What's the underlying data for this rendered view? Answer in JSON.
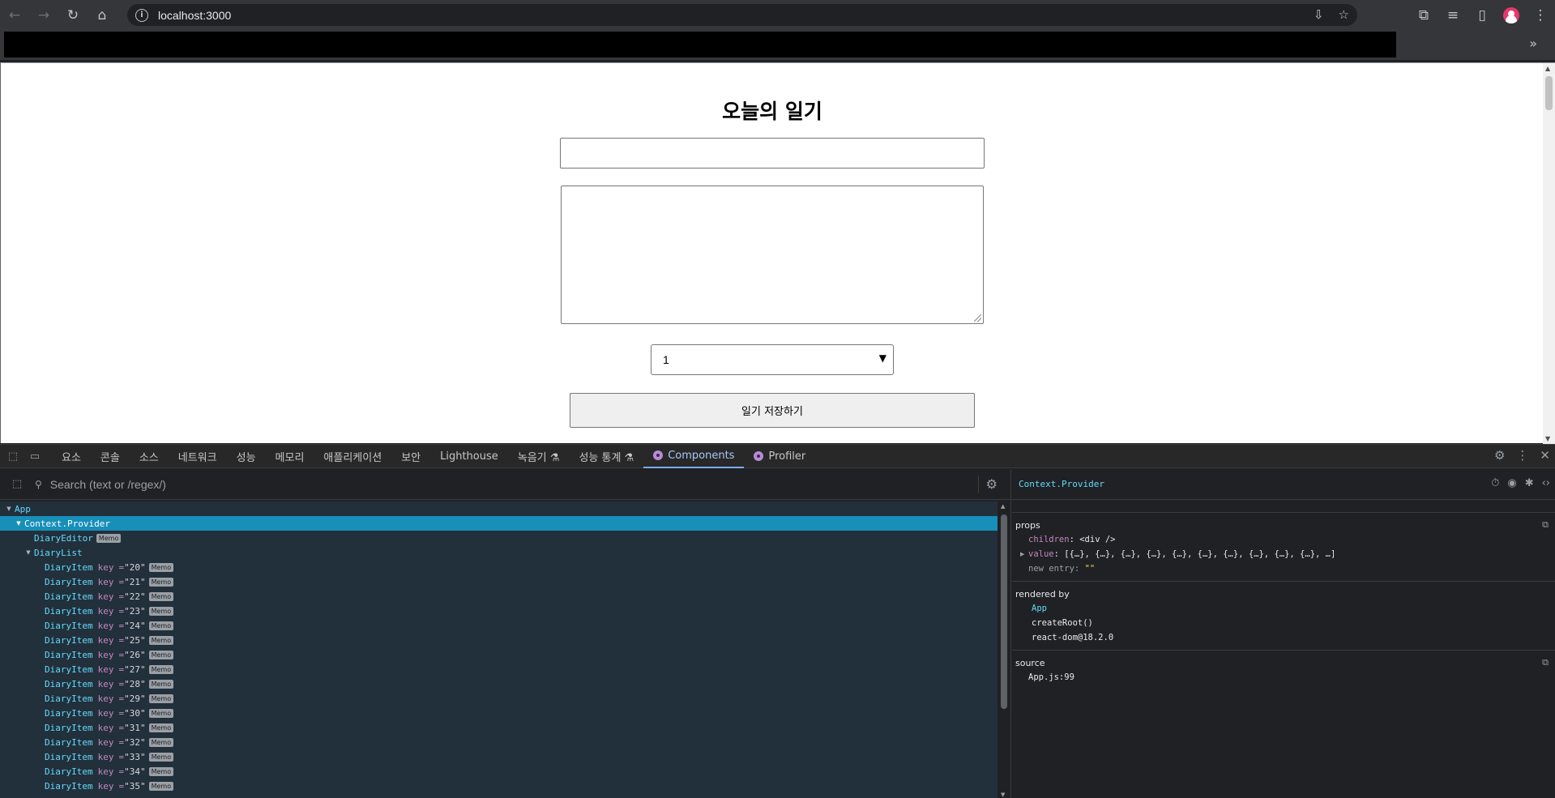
{
  "browser": {
    "url": "localhost:3000"
  },
  "page": {
    "title": "오늘의 일기",
    "author_value": "",
    "content_value": "",
    "emotion_selected": "1",
    "save_button": "일기 저장하기"
  },
  "devtools": {
    "tabs": [
      "요소",
      "콘솔",
      "소스",
      "네트워크",
      "성능",
      "메모리",
      "애플리케이션",
      "보안",
      "Lighthouse",
      "녹음기 ⚗",
      "성능 통계 ⚗"
    ],
    "react_tabs": [
      "Components",
      "Profiler"
    ],
    "active_tab": "Components",
    "search_placeholder": "Search (text or /regex/)",
    "tree": {
      "app": "App",
      "provider": "Context.Provider",
      "editor": "DiaryEditor",
      "list": "DiaryList",
      "item_name": "DiaryItem",
      "key_label": "key",
      "badge": "Memo",
      "item_keys": [
        "\"20\"",
        "\"21\"",
        "\"22\"",
        "\"23\"",
        "\"24\"",
        "\"25\"",
        "\"26\"",
        "\"27\"",
        "\"28\"",
        "\"29\"",
        "\"30\"",
        "\"31\"",
        "\"32\"",
        "\"33\"",
        "\"34\"",
        "\"35\""
      ]
    },
    "inspector": {
      "title": "Context.Provider",
      "props_label": "props",
      "children_key": "children",
      "children_val": "<div />",
      "value_key": "value",
      "value_val": "[{…}, {…}, {…}, {…}, {…}, {…}, {…}, {…}, {…}, {…}, …]",
      "new_entry_key": "new entry",
      "new_entry_val": "\"\"",
      "rendered_by_label": "rendered by",
      "rendered_by": [
        "App",
        "createRoot()",
        "react-dom@18.2.0"
      ],
      "source_label": "source",
      "source_val": "App.js:99"
    }
  }
}
